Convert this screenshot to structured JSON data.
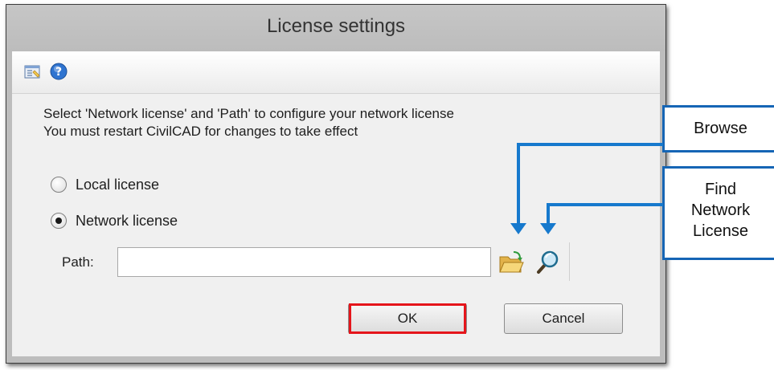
{
  "window": {
    "title": "License settings"
  },
  "toolbar": {
    "props_icon": "properties-icon",
    "help_icon": "help-icon"
  },
  "message": {
    "line1": "Select 'Network license' and 'Path' to configure your network license",
    "line2": "You must restart CivilCAD for changes to take effect"
  },
  "options": {
    "local_label": "Local license",
    "network_label": "Network license",
    "selected": "network"
  },
  "path": {
    "label": "Path:",
    "value": ""
  },
  "icons": {
    "browse": "open-folder-icon",
    "find": "magnifier-icon"
  },
  "buttons": {
    "ok": "OK",
    "cancel": "Cancel"
  },
  "callouts": {
    "browse": "Browse",
    "find_line1": "Find",
    "find_line2": "Network",
    "find_line3": "License"
  },
  "colors": {
    "callout_border": "#1565b5",
    "arrow": "#1679cd",
    "highlight": "#e5151b"
  }
}
